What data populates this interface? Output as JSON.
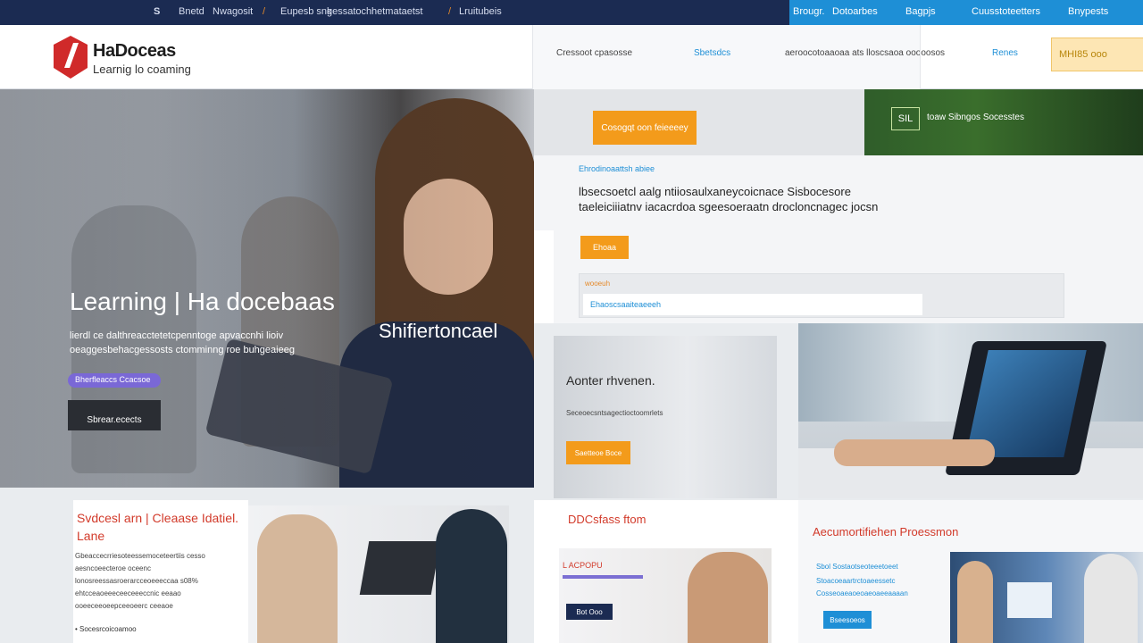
{
  "topbar": {
    "left": [
      "S",
      "Bnetd",
      "Nwagosit",
      "/",
      "Eupesb snk",
      "gessatoch",
      "hetmataetst",
      "/",
      "Lruitubeis"
    ],
    "right": [
      "Brougr.",
      "Dotoarbes",
      "Bagpjs",
      "Cuusstoteetters",
      "Bnypests"
    ]
  },
  "header": {
    "logo_title": "HaDoceas",
    "logo_sub": "Learnig lo coaming",
    "mid_left": "Cressoot cpasosse",
    "mid_blue": "Sbetsdcs",
    "mid_right": "aeroocotoaaoaa ats lloscsaoa ooooosos",
    "right_link": "Renes",
    "cta": "MHI85 ooo"
  },
  "hero": {
    "title": "Learning | Ha docebaas",
    "description": "lierdl ce dalthreacctetetcpenntoge apvaccnhi lioiv oeaggesbehacgessosts ctomminng roe buhgeaieeg",
    "brand": "Shifiertoncael",
    "tag": "Bherfleaccs Ccacsoe",
    "button": "Sbrear.ecects"
  },
  "promo": {
    "button": "Cosogqt oon feieeeey"
  },
  "green": {
    "badge": "SIL",
    "text": "toaw Sibngos Socesstes"
  },
  "intro": {
    "eyebrow": "Ehrodinoaattsh abiee",
    "body": "lbsecsoetcl aalg ntiiosaulxaneycoicnace Sisbocesore taeleiciiiatnv iacacrdoa sgeesoeraatn drocloncnagec jocsn",
    "button": "Ehoaa",
    "panel_label": "wooeuh",
    "panel_text": "Ehaoscsaaiteaeeeh"
  },
  "card_a": {
    "heading": "Aonter rhvenen.",
    "sub": "Seceoecsntsagectioctoomrlets",
    "button": "Saetteoe Boce"
  },
  "bottom": {
    "col1": {
      "heading": "Svdcesl arn | Cleaase Idatiel. Lane",
      "para": "Gbeaccecrriesoteessemoceteertiis cesso aesncoeecteroe oceenc lonosreessasroerarcceoeeeccaa s08% ehtcceaoeeeceeceeeccnic eeaao ooeeceeoeepceeoeerc ceeaoe",
      "footer": "• Socesrcoicoamoo"
    },
    "col2": {
      "heading": "DDCsfass ftom",
      "card_label": "L ACPOPU",
      "button": "Bot Ooo"
    },
    "col3": {
      "heading": "Aecumortifiehen Proessmon",
      "lines": [
        "Sbol Sostaotseoteeetoeet",
        "Stoacoeaartrctoaeessetc",
        "Cosseoaeaoeoaeoaeeaaaan"
      ],
      "button": "Bseesoeos"
    }
  },
  "colors": {
    "navy": "#1b2b52",
    "blue": "#1e8fd6",
    "orange": "#f39b1b",
    "red": "#d23a2a"
  }
}
